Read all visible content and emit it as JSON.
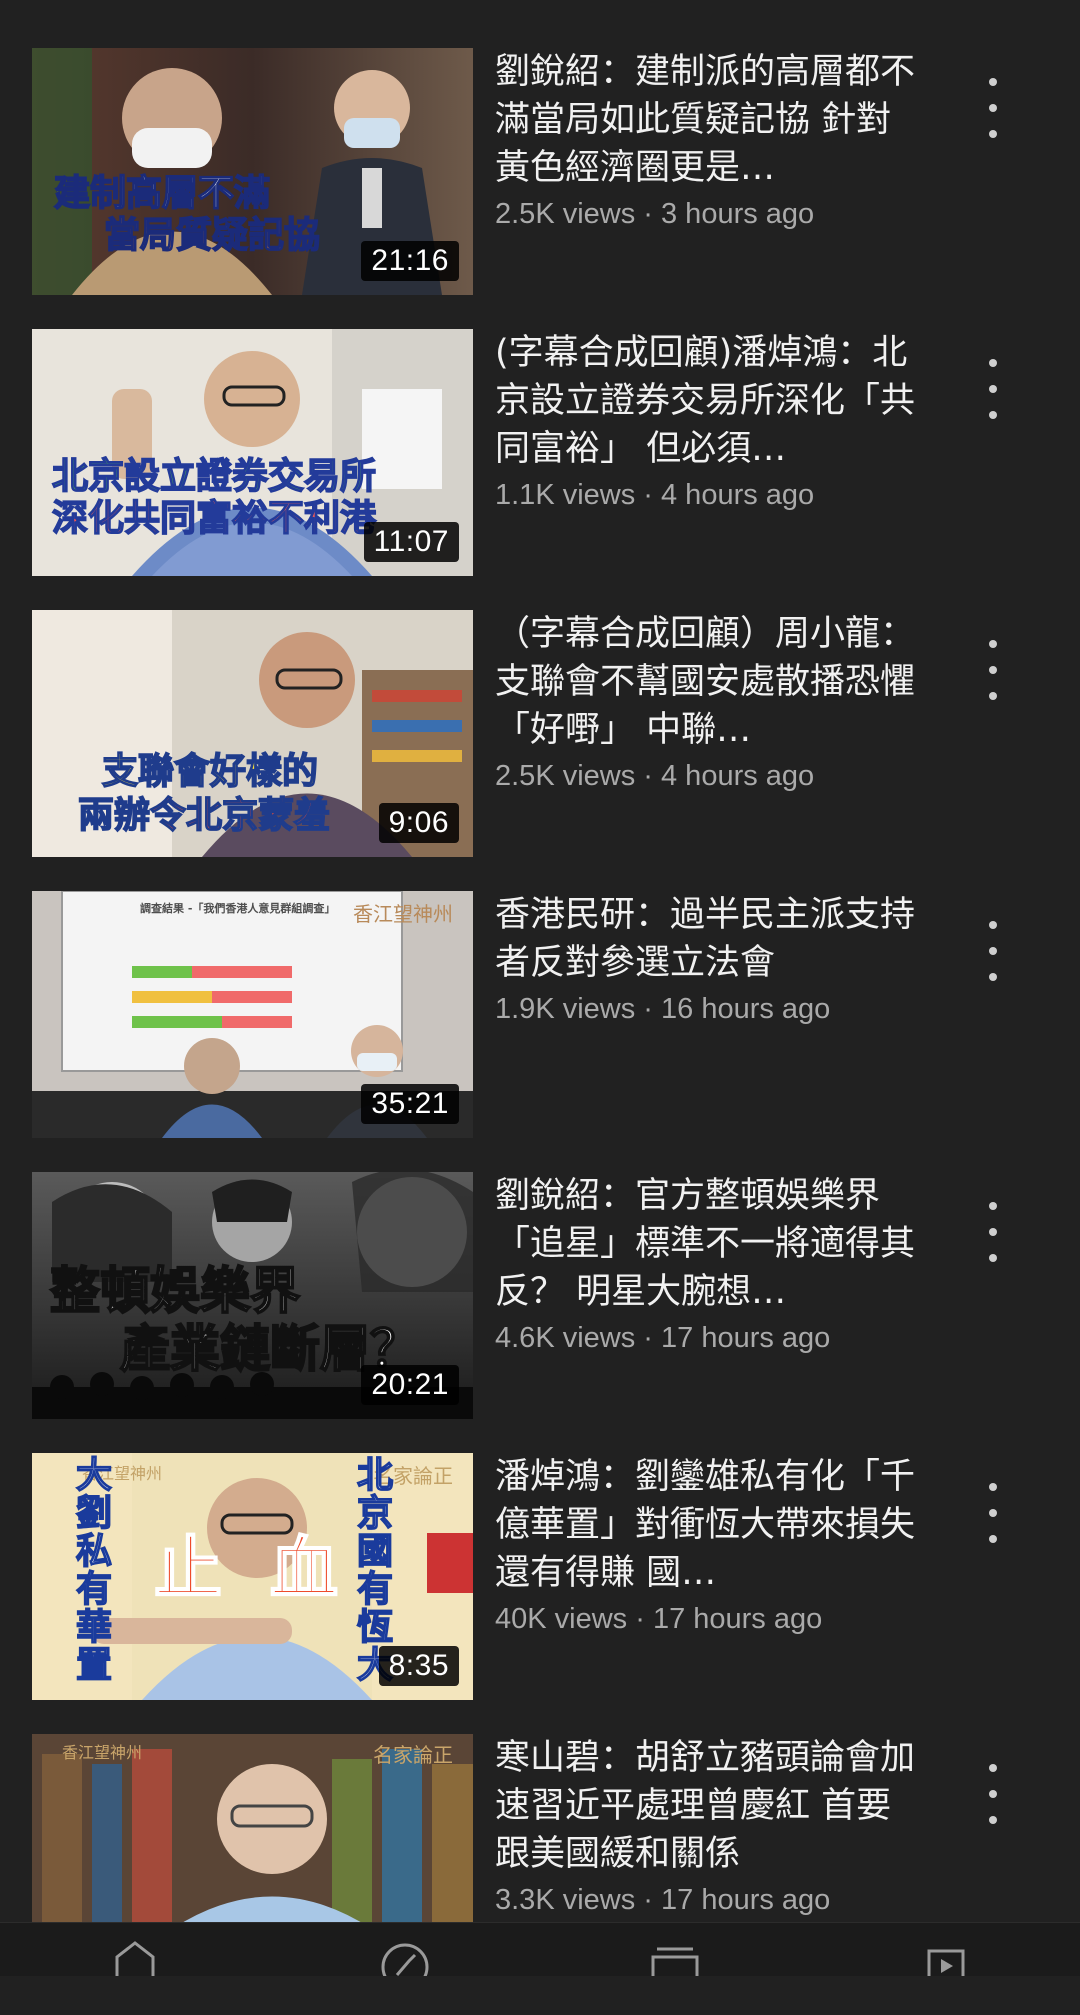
{
  "videos": [
    {
      "title": "劉銳紹：建制派的高層都不滿當局如此質疑記協 針對黃色經濟圈更是…",
      "meta": "2.5K views · 3 hours ago",
      "duration": "21:16",
      "thumb_caption_1": "建制高層不滿",
      "thumb_caption_2": "當局質疑記協"
    },
    {
      "title": "(字幕合成回顧)潘焯鴻：北京設立證券交易所深化「共同富裕」 但必須…",
      "meta": "1.1K views · 4 hours ago",
      "duration": "11:07",
      "thumb_caption_1": "北京設立證券交易所",
      "thumb_caption_2": "深化共同富裕不利港"
    },
    {
      "title": "（字幕合成回顧）周小龍：支聯會不幫國安處散播恐懼「好嘢」 中聯…",
      "meta": "2.5K views · 4 hours ago",
      "duration": "9:06",
      "thumb_caption_1": "支聯會好樣的",
      "thumb_caption_2": "兩辦令北京蒙羞"
    },
    {
      "title": "香港民研：過半民主派支持者反對參選立法會",
      "meta": "1.9K views · 16 hours ago",
      "duration": "35:21",
      "thumb_caption_1": "調查結果 -「我們香港人意見群組調查」",
      "thumb_caption_2": "香江望神州"
    },
    {
      "title": "劉銳紹：官方整頓娛樂界「追星」標準不一將適得其反？ 明星大腕想…",
      "meta": "4.6K views · 17 hours ago",
      "duration": "20:21",
      "thumb_caption_1": "整頓娛樂界",
      "thumb_caption_2": "產業鏈斷層？"
    },
    {
      "title": "潘焯鴻：劉鑾雄私有化「千億華置」對衝恆大帶來損失 還有得賺 國…",
      "meta": "40K views · 17 hours ago",
      "duration": "8:35",
      "thumb_caption_1": "止血",
      "thumb_caption_2": "大劉私有華置",
      "thumb_caption_3": "北京國有恆大",
      "thumb_corner_left": "香江望神州",
      "thumb_corner_right": "名家論正"
    },
    {
      "title": "寒山碧：胡舒立豬頭論會加速習近平處理曾慶紅 首要跟美國緩和關係",
      "meta": "3.3K views · 17 hours ago",
      "duration": "",
      "thumb_corner_left": "香江望神州",
      "thumb_corner_right": "名家論正"
    }
  ],
  "colors": {
    "background": "#212121",
    "title": "#f1f1f1",
    "meta": "#aaaaaa"
  },
  "icons": {
    "more": "more-vert-icon",
    "nav": [
      "home-icon",
      "explore-icon",
      "subscriptions-icon",
      "library-icon"
    ]
  }
}
